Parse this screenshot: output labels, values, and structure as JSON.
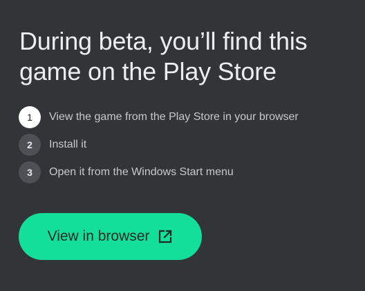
{
  "dialog": {
    "title": "During beta, you’ll find this game on the Play Store",
    "steps": [
      {
        "number": "1",
        "text": "View the game from the Play Store in your browser",
        "state": "current"
      },
      {
        "number": "2",
        "text": "Install it",
        "state": "upcoming"
      },
      {
        "number": "3",
        "text": "Open it from the Windows Start menu",
        "state": "upcoming"
      }
    ],
    "cta": {
      "label": "View in browser",
      "icon": "open-in-new-icon"
    }
  },
  "colors": {
    "background": "#333438",
    "accent": "#13df9b",
    "title": "#eceef0",
    "step_text": "#c7c9cc"
  }
}
